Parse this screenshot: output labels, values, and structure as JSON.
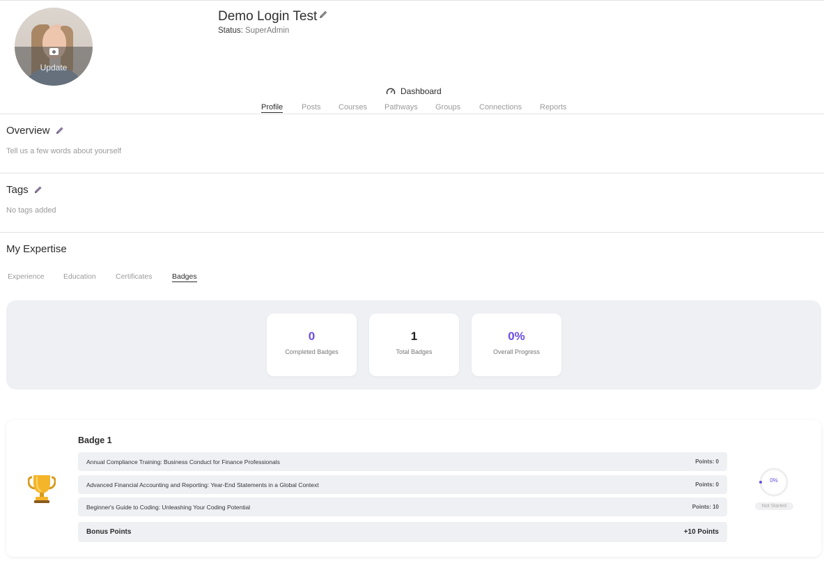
{
  "profile": {
    "name": "Demo Login Test",
    "status_label": "Status:",
    "status_value": "SuperAdmin",
    "avatar_update_label": "Update"
  },
  "dashboard_label": "Dashboard",
  "tabs": [
    {
      "label": "Profile",
      "active": true
    },
    {
      "label": "Posts"
    },
    {
      "label": "Courses"
    },
    {
      "label": "Pathways"
    },
    {
      "label": "Groups"
    },
    {
      "label": "Connections"
    },
    {
      "label": "Reports"
    }
  ],
  "overview": {
    "title": "Overview",
    "placeholder": "Tell us a few words about yourself"
  },
  "tags": {
    "title": "Tags",
    "empty": "No tags added"
  },
  "expertise": {
    "title": "My Expertise",
    "tabs": [
      {
        "label": "Experience"
      },
      {
        "label": "Education"
      },
      {
        "label": "Certificates"
      },
      {
        "label": "Badges",
        "active": true
      }
    ]
  },
  "stats": [
    {
      "value": "0",
      "label": "Completed Badges",
      "color": "#6b4de6"
    },
    {
      "value": "1",
      "label": "Total Badges",
      "color": "#1f1f1f"
    },
    {
      "value": "0%",
      "label": "Overall Progress",
      "color": "#6b4de6"
    }
  ],
  "badge": {
    "title": "Badge 1",
    "courses": [
      {
        "name": "Annual Compliance Training: Business Conduct for Finance Professionals",
        "points": "Points: 0"
      },
      {
        "name": "Advanced Financial Accounting and Reporting: Year-End Statements in a Global Context",
        "points": "Points: 0"
      },
      {
        "name": "Beginner's Guide to Coding: Unleashing Your Coding Potential",
        "points": "Points: 10"
      }
    ],
    "bonus_label": "Bonus Points",
    "bonus_value": "+10 Points",
    "progress_label": "0%",
    "progress": 0,
    "status": "Not Started",
    "icon": "trophy-icon"
  },
  "colors": {
    "accent": "#6b4de6",
    "panel": "#eef0f4"
  }
}
